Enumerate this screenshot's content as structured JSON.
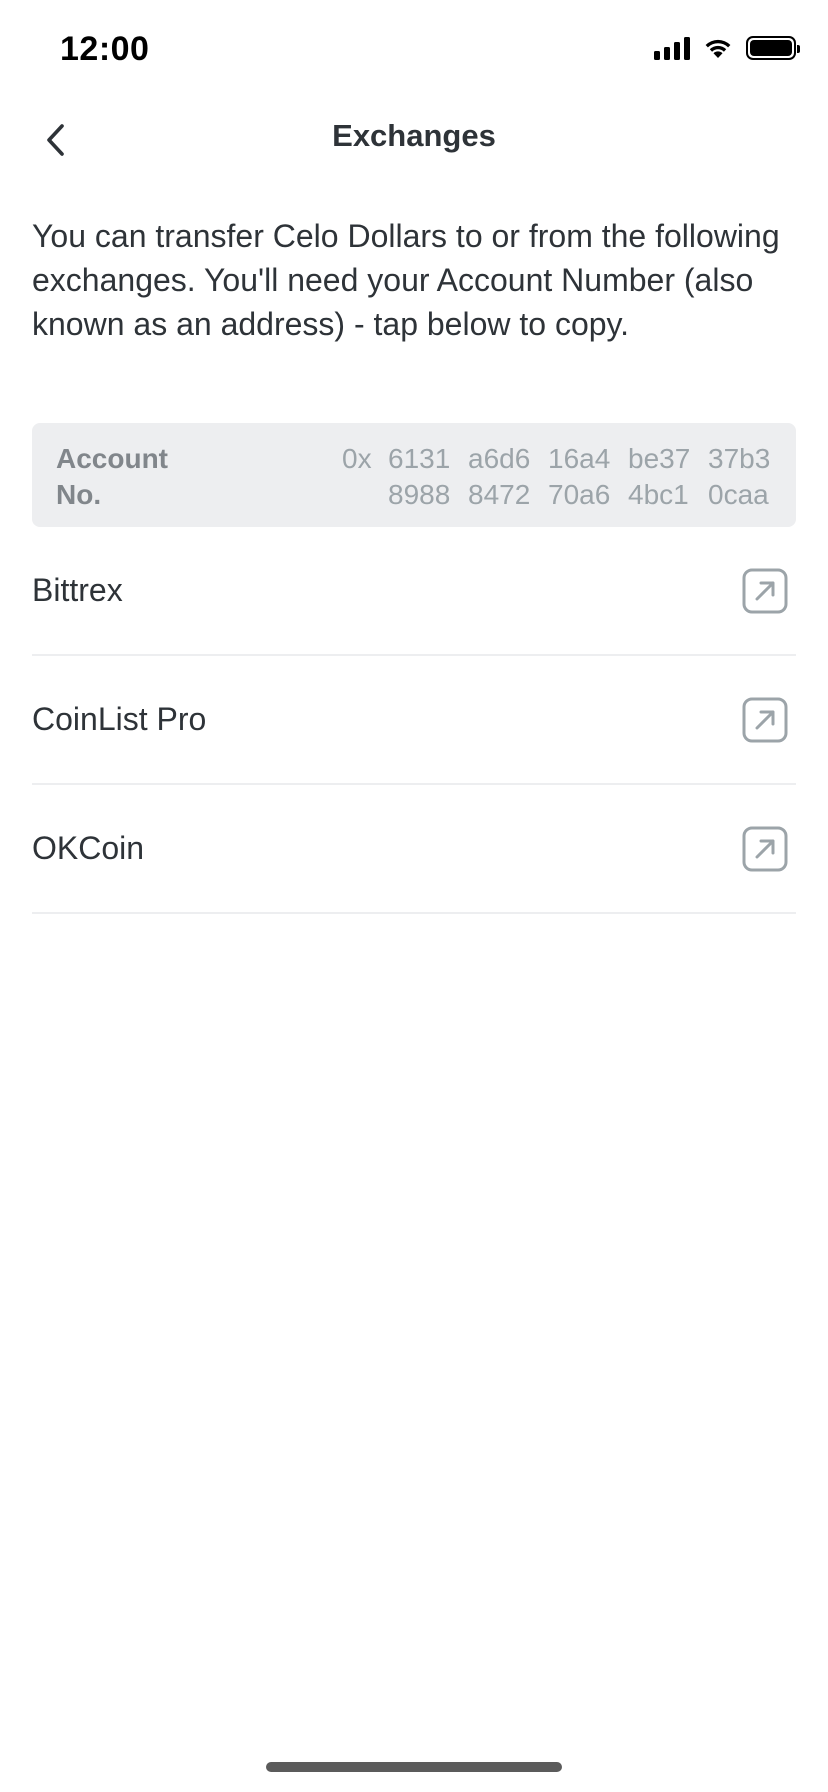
{
  "status_bar": {
    "time": "12:00"
  },
  "header": {
    "title": "Exchanges",
    "back_icon": "chevron-left-icon"
  },
  "description": "You can transfer Celo Dollars to or from the following exchanges. You'll need your Account Number (also known as an address) - tap below to copy.",
  "account": {
    "label": "Account No.",
    "prefix": "0x",
    "line1": [
      "6131",
      "a6d6",
      "16a4",
      "be37",
      "37b3"
    ],
    "line2": [
      "8988",
      "8472",
      "70a6",
      "4bc1",
      "0caa"
    ]
  },
  "exchanges": [
    {
      "name": "Bittrex",
      "icon": "external-link-icon"
    },
    {
      "name": "CoinList Pro",
      "icon": "external-link-icon"
    },
    {
      "name": "OKCoin",
      "icon": "external-link-icon"
    }
  ],
  "colors": {
    "text_primary": "#2e3338",
    "text_muted": "#81868b",
    "account_box_bg": "#edeef0",
    "divider": "#edeef0"
  }
}
